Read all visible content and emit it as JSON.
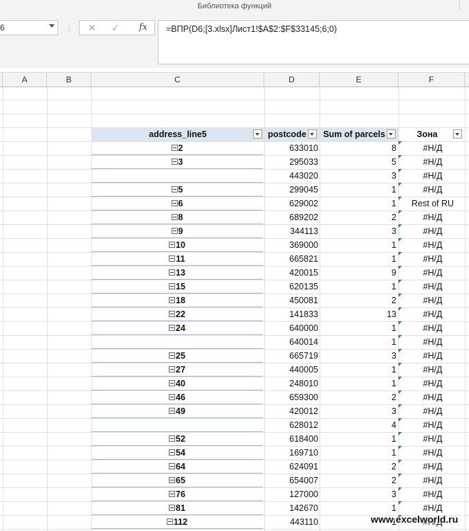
{
  "ribbon": {
    "title": "Библиотека функций"
  },
  "name_box": {
    "value": "6"
  },
  "formula_bar": {
    "cancel_icon": "cancel-icon",
    "enter_icon": "check-icon",
    "fx_label": "fx",
    "formula": "=ВПР(D6;[3.xlsx]Лист1!$A$2:$F$33145;6;0)"
  },
  "columns": [
    "A",
    "B",
    "C",
    "D",
    "E",
    "F"
  ],
  "pivot": {
    "headers": [
      "address_line5",
      "postcode",
      "Sum of parcels",
      "Зона"
    ],
    "rows": [
      {
        "address": "2",
        "postcode": "633010",
        "sum": "8",
        "zona": "#Н/Д"
      },
      {
        "address": "3",
        "postcode": "295033",
        "sum": "5",
        "zona": "#Н/Д"
      },
      {
        "address": "",
        "postcode": "443020",
        "sum": "3",
        "zona": "#Н/Д"
      },
      {
        "address": "5",
        "postcode": "299045",
        "sum": "1",
        "zona": "#Н/Д"
      },
      {
        "address": "6",
        "postcode": "629002",
        "sum": "1",
        "zona": "Rest of RU"
      },
      {
        "address": "8",
        "postcode": "689202",
        "sum": "2",
        "zona": "#Н/Д"
      },
      {
        "address": "9",
        "postcode": "344113",
        "sum": "3",
        "zona": "#Н/Д"
      },
      {
        "address": "10",
        "postcode": "369000",
        "sum": "1",
        "zona": "#Н/Д"
      },
      {
        "address": "11",
        "postcode": "665821",
        "sum": "1",
        "zona": "#Н/Д"
      },
      {
        "address": "13",
        "postcode": "420015",
        "sum": "9",
        "zona": "#Н/Д"
      },
      {
        "address": "15",
        "postcode": "620135",
        "sum": "1",
        "zona": "#Н/Д"
      },
      {
        "address": "18",
        "postcode": "450081",
        "sum": "2",
        "zona": "#Н/Д"
      },
      {
        "address": "22",
        "postcode": "141833",
        "sum": "13",
        "zona": "#Н/Д"
      },
      {
        "address": "24",
        "postcode": "640000",
        "sum": "1",
        "zona": "#Н/Д"
      },
      {
        "address": "",
        "postcode": "640014",
        "sum": "1",
        "zona": "#Н/Д"
      },
      {
        "address": "25",
        "postcode": "665719",
        "sum": "3",
        "zona": "#Н/Д"
      },
      {
        "address": "27",
        "postcode": "440005",
        "sum": "1",
        "zona": "#Н/Д"
      },
      {
        "address": "40",
        "postcode": "248010",
        "sum": "1",
        "zona": "#Н/Д"
      },
      {
        "address": "46",
        "postcode": "659300",
        "sum": "2",
        "zona": "#Н/Д"
      },
      {
        "address": "49",
        "postcode": "420012",
        "sum": "3",
        "zona": "#Н/Д"
      },
      {
        "address": "",
        "postcode": "628012",
        "sum": "4",
        "zona": "#Н/Д"
      },
      {
        "address": "52",
        "postcode": "618400",
        "sum": "1",
        "zona": "#Н/Д"
      },
      {
        "address": "54",
        "postcode": "169710",
        "sum": "1",
        "zona": "#Н/Д"
      },
      {
        "address": "64",
        "postcode": "624091",
        "sum": "2",
        "zona": "#Н/Д"
      },
      {
        "address": "65",
        "postcode": "654007",
        "sum": "2",
        "zona": "#Н/Д"
      },
      {
        "address": "76",
        "postcode": "127000",
        "sum": "3",
        "zona": "#Н/Д"
      },
      {
        "address": "81",
        "postcode": "142670",
        "sum": "1",
        "zona": "#Н/Д"
      },
      {
        "address": "112",
        "postcode": "443110",
        "sum": "1",
        "zona": "#Н/Д"
      }
    ]
  },
  "watermark": "www.excelworld.ru",
  "colors": {
    "pivot_header_bg": "#dce6f1",
    "row_line": "#9bb7dd",
    "error_triangle": "#1e8a3c"
  }
}
